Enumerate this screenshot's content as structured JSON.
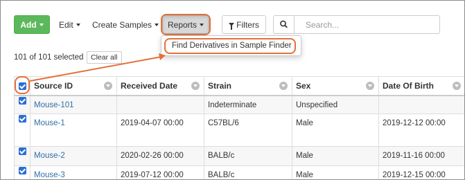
{
  "toolbar": {
    "add_label": "Add",
    "edit_label": "Edit",
    "create_samples_label": "Create Samples",
    "reports_label": "Reports",
    "filters_label": "Filters",
    "search_placeholder": "Search..."
  },
  "dropdown": {
    "items": [
      {
        "label": "Find Derivatives in Sample Finder"
      }
    ]
  },
  "selection": {
    "text": "101 of 101 selected",
    "clear_label": "Clear all"
  },
  "table": {
    "columns": [
      "Source ID",
      "Received Date",
      "Strain",
      "Sex",
      "Date Of Birth"
    ],
    "rows": [
      {
        "checked": true,
        "source_id": "Mouse-101",
        "received_date": "",
        "strain": "Indeterminate",
        "sex": "Unspecified",
        "date_of_birth": ""
      },
      {
        "checked": true,
        "source_id": "Mouse-1",
        "received_date": "2019-04-07 00:00",
        "strain": "C57BL/6",
        "sex": "Male",
        "date_of_birth": "2019-12-12 00:00"
      },
      {
        "checked": true,
        "source_id": "Mouse-2",
        "received_date": "2020-02-26 00:00",
        "strain": "BALB/c",
        "sex": "Male",
        "date_of_birth": "2019-11-16 00:00"
      },
      {
        "checked": true,
        "source_id": "Mouse-3",
        "received_date": "2019-07-12 00:00",
        "strain": "BALB/c",
        "sex": "Male",
        "date_of_birth": "2019-12-15 00:00"
      }
    ]
  },
  "colors": {
    "add_button": "#5cb85c",
    "link": "#2f6fa8",
    "checkbox": "#2a6fd6",
    "highlight": "#e4703a"
  }
}
